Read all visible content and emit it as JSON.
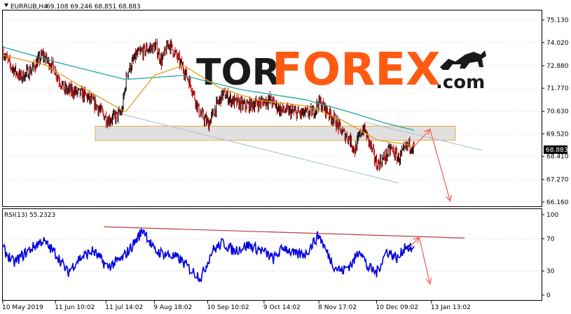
{
  "header": {
    "title": "EURRUB,H4",
    "ohlc": "69.108 69.246 68.851 68.883"
  },
  "logo": {
    "tor": "TOR",
    "forex": "FOREX",
    "com": ".com"
  },
  "rsi_header": "RSI(13) 55.2323",
  "colors": {
    "bull": "#000000",
    "bear": "#d40000",
    "ma_fast": "#e0a020",
    "ma_slow": "#20a8a0",
    "channel": "#b4c4d8",
    "zone_fill": "#e0e0e0",
    "zone_border": "#e0b040",
    "arrow": "#f07068",
    "rsi": "#0000dd",
    "rsi_trend": "#b04040",
    "grid": "#c0c0c0"
  },
  "chart_data": [
    {
      "type": "candlestick",
      "title": "EURRUB,H4",
      "ylabel": "",
      "y_ticks": [
        "75.130",
        "74.020",
        "72.880",
        "71.770",
        "70.630",
        "69.520",
        "68.410",
        "67.270",
        "66.160"
      ],
      "ylim": [
        65.95,
        75.6
      ],
      "current_price": "68.883",
      "x_ticks": [
        "10 May 2019",
        "11 Jun 10:02",
        "11 Jul 14:02",
        "9 Aug 18:02",
        "10 Sep 10:02",
        "9 Oct 14:02",
        "8 Nov 17:02",
        "10 Dec 09:02",
        "13 Jan 13:02"
      ],
      "x_tick_pos": [
        0,
        73,
        143,
        210,
        284,
        362,
        438,
        518,
        594
      ],
      "n_bars": 600,
      "close_keypoints": [
        [
          0,
          73.6
        ],
        [
          10,
          72.9
        ],
        [
          25,
          72.3
        ],
        [
          40,
          72.7
        ],
        [
          55,
          73.4
        ],
        [
          70,
          72.8
        ],
        [
          85,
          71.7
        ],
        [
          100,
          71.6
        ],
        [
          115,
          71.4
        ],
        [
          130,
          70.9
        ],
        [
          145,
          70.2
        ],
        [
          158,
          70.4
        ],
        [
          165,
          70.6
        ],
        [
          172,
          72.5
        ],
        [
          185,
          73.4
        ],
        [
          200,
          73.7
        ],
        [
          212,
          73.8
        ],
        [
          220,
          73.1
        ],
        [
          230,
          74.0
        ],
        [
          240,
          73.4
        ],
        [
          252,
          72.6
        ],
        [
          262,
          71.8
        ],
        [
          272,
          70.6
        ],
        [
          285,
          70.0
        ],
        [
          295,
          70.8
        ],
        [
          305,
          71.5
        ],
        [
          320,
          71.1
        ],
        [
          335,
          70.9
        ],
        [
          350,
          71.0
        ],
        [
          370,
          71.2
        ],
        [
          385,
          70.7
        ],
        [
          400,
          70.6
        ],
        [
          415,
          70.5
        ],
        [
          430,
          70.6
        ],
        [
          438,
          71.1
        ],
        [
          448,
          70.7
        ],
        [
          460,
          70.2
        ],
        [
          470,
          69.6
        ],
        [
          480,
          69.3
        ],
        [
          488,
          68.7
        ],
        [
          495,
          69.5
        ],
        [
          500,
          69.8
        ],
        [
          510,
          68.9
        ],
        [
          518,
          68.0
        ],
        [
          528,
          68.3
        ],
        [
          538,
          68.8
        ],
        [
          548,
          68.3
        ],
        [
          555,
          68.6
        ],
        [
          562,
          69.0
        ],
        [
          570,
          68.883
        ]
      ],
      "ma_fast_keypoints": [
        [
          0,
          73.4
        ],
        [
          60,
          72.9
        ],
        [
          120,
          71.6
        ],
        [
          170,
          70.6
        ],
        [
          210,
          72.4
        ],
        [
          250,
          72.9
        ],
        [
          300,
          71.8
        ],
        [
          350,
          71.2
        ],
        [
          420,
          70.9
        ],
        [
          470,
          70.2
        ],
        [
          520,
          69.2
        ],
        [
          570,
          68.95
        ]
      ],
      "ma_slow_keypoints": [
        [
          0,
          73.8
        ],
        [
          80,
          73.0
        ],
        [
          170,
          72.2
        ],
        [
          250,
          72.4
        ],
        [
          330,
          71.7
        ],
        [
          420,
          71.2
        ],
        [
          480,
          70.6
        ],
        [
          530,
          70.05
        ],
        [
          570,
          69.7
        ]
      ],
      "resistance_zone": [
        69.2,
        69.9
      ],
      "zone_bars": [
        165,
        840
      ],
      "channel_upper": [
        [
          635,
          70.1
        ],
        [
          886,
          68.7
        ]
      ],
      "channel_lower": [
        [
          286,
          70.6
        ],
        [
          770,
          67.1
        ]
      ],
      "projection": [
        [
          570,
          68.9
        ],
        [
          592,
          69.75
        ],
        [
          620,
          66.2
        ]
      ],
      "note": "x values are bar indices; 0 = 10 May 2019"
    },
    {
      "type": "line",
      "title": "RSI(13) 55.2323",
      "y_ticks": [
        "100",
        "70",
        "30",
        "0"
      ],
      "ylim": [
        0,
        100
      ],
      "levels": [
        70,
        30
      ],
      "rsi_keypoints": [
        [
          0,
          58
        ],
        [
          15,
          40
        ],
        [
          35,
          55
        ],
        [
          55,
          68
        ],
        [
          75,
          50
        ],
        [
          90,
          28
        ],
        [
          105,
          45
        ],
        [
          125,
          55
        ],
        [
          145,
          35
        ],
        [
          165,
          45
        ],
        [
          180,
          62
        ],
        [
          195,
          82
        ],
        [
          210,
          55
        ],
        [
          230,
          50
        ],
        [
          245,
          45
        ],
        [
          262,
          30
        ],
        [
          275,
          22
        ],
        [
          290,
          55
        ],
        [
          305,
          65
        ],
        [
          320,
          55
        ],
        [
          340,
          62
        ],
        [
          360,
          55
        ],
        [
          375,
          45
        ],
        [
          390,
          60
        ],
        [
          405,
          50
        ],
        [
          420,
          52
        ],
        [
          438,
          75
        ],
        [
          448,
          55
        ],
        [
          460,
          35
        ],
        [
          470,
          30
        ],
        [
          485,
          40
        ],
        [
          495,
          58
        ],
        [
          505,
          35
        ],
        [
          518,
          28
        ],
        [
          532,
          55
        ],
        [
          548,
          45
        ],
        [
          558,
          62
        ],
        [
          570,
          55
        ]
      ],
      "trendline": [
        [
          140,
          85
        ],
        [
          640,
          71
        ]
      ],
      "projection": [
        [
          562,
          58
        ],
        [
          577,
          72
        ],
        [
          592,
          14
        ]
      ]
    }
  ]
}
